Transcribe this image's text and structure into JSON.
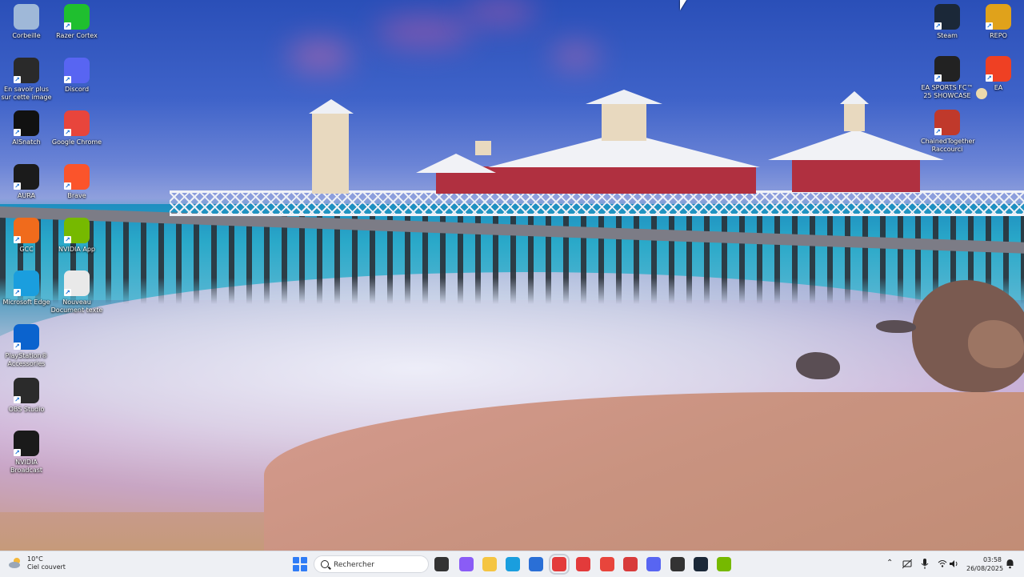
{
  "desktop": {
    "icons_left": [
      {
        "label": "Corbeille",
        "icon": "recycle-bin-icon",
        "color": "#9fb8d8"
      },
      {
        "label": "Razer Cortex",
        "icon": "razer-cortex-icon",
        "color": "#1fbf2f"
      },
      {
        "label": "En savoir plus sur cette image",
        "icon": "learn-about-image-icon",
        "color": "#2a2a2a"
      },
      {
        "label": "Discord",
        "icon": "discord-icon",
        "color": "#5865f2"
      },
      {
        "label": "AISnatch",
        "icon": "aisnatch-icon",
        "color": "#111111"
      },
      {
        "label": "Google Chrome",
        "icon": "chrome-icon",
        "color": "#e8453c"
      },
      {
        "label": "AURA",
        "icon": "aura-icon",
        "color": "#1b1b1b"
      },
      {
        "label": "Brave",
        "icon": "brave-icon",
        "color": "#fb542b"
      },
      {
        "label": "GCC",
        "icon": "gcc-icon",
        "color": "#f06b1c"
      },
      {
        "label": "NVIDIA App",
        "icon": "nvidia-app-icon",
        "color": "#76b900"
      },
      {
        "label": "Microsoft Edge",
        "icon": "edge-icon",
        "color": "#1a9ede"
      },
      {
        "label": "Nouveau Document texte",
        "icon": "text-document-icon",
        "color": "#e9e9e9"
      },
      {
        "label": "PlayStation® Accessories",
        "icon": "playstation-accessories-icon",
        "color": "#0b63ce"
      },
      {
        "label": "OBS Studio",
        "icon": "obs-icon",
        "color": "#2b2b2b"
      },
      {
        "label": "NVIDIA Broadcast",
        "icon": "nvidia-broadcast-icon",
        "color": "#1a1a1a"
      }
    ],
    "icons_right": [
      {
        "label": "Steam",
        "icon": "steam-icon",
        "color": "#1b2838"
      },
      {
        "label": "REPO",
        "icon": "repo-icon",
        "color": "#e0a21b"
      },
      {
        "label": "EA SPORTS FC™ 25 SHOWCASE",
        "icon": "ea-fc-icon",
        "color": "#222222"
      },
      {
        "label": "EA",
        "icon": "ea-icon",
        "color": "#ef4023"
      },
      {
        "label": "ChainedTogether Raccourci",
        "icon": "chained-together-icon",
        "color": "#c0392b"
      }
    ]
  },
  "taskbar": {
    "weather": {
      "temp": "10°C",
      "condition": "Ciel couvert"
    },
    "search_placeholder": "Rechercher",
    "apps": [
      {
        "name": "task-view",
        "color": "#333333"
      },
      {
        "name": "copilot",
        "color": "#8a5cf6"
      },
      {
        "name": "file-explorer",
        "color": "#f5c542"
      },
      {
        "name": "edge",
        "color": "#1a9ede"
      },
      {
        "name": "microsoft-store",
        "color": "#2a6fd6"
      },
      {
        "name": "anydesk-1",
        "color": "#e33b3b"
      },
      {
        "name": "anydesk-2",
        "color": "#e33b3b"
      },
      {
        "name": "chrome",
        "color": "#e8453c"
      },
      {
        "name": "video-app",
        "color": "#d83b3b"
      },
      {
        "name": "discord",
        "color": "#5865f2"
      },
      {
        "name": "obs",
        "color": "#333333"
      },
      {
        "name": "steam",
        "color": "#1b2838"
      },
      {
        "name": "nvidia-broadcast",
        "color": "#76b900"
      }
    ],
    "time": "03:58",
    "date": "26/08/2025"
  }
}
